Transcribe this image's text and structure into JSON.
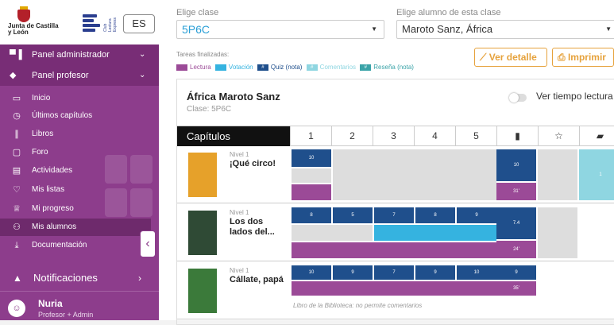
{
  "sidebar": {
    "logo_text": "Junta de Castilla y León",
    "brand_vertical": "Club Lectura Express",
    "lang": "ES",
    "sections": [
      {
        "label": "Panel administrador",
        "icon": "admin-icon"
      },
      {
        "label": "Panel profesor",
        "icon": "teacher-icon"
      }
    ],
    "items": [
      {
        "label": "Inicio",
        "icon": "monitor-icon"
      },
      {
        "label": "Últimos capítulos",
        "icon": "clock-icon"
      },
      {
        "label": "Libros",
        "icon": "books-icon"
      },
      {
        "label": "Foro",
        "icon": "chat-icon"
      },
      {
        "label": "Actividades",
        "icon": "activity-icon"
      },
      {
        "label": "Mis listas",
        "icon": "heart-icon"
      },
      {
        "label": "Mi progreso",
        "icon": "trophy-icon"
      },
      {
        "label": "Mis alumnos",
        "icon": "students-icon"
      },
      {
        "label": "Documentación",
        "icon": "download-icon"
      }
    ],
    "notifications": "Notificaciones",
    "user": {
      "name": "Nuria",
      "role": "Profesor + Admin"
    }
  },
  "main": {
    "class_label": "Elige clase",
    "class_value": "5P6C",
    "student_label": "Elige alumno de esta clase",
    "student_value": "Maroto Sanz, África",
    "legend_title": "Tareas finalizadas:",
    "legend": [
      {
        "label": "Lectura",
        "color": "#9b4a97",
        "mark": ""
      },
      {
        "label": "Votación",
        "color": "#35b3e0",
        "mark": ""
      },
      {
        "label": "Quiz (nota)",
        "color": "#1f4f8c",
        "mark": "#"
      },
      {
        "label": "Comentarios",
        "color": "#8fd6e1",
        "mark": "#"
      },
      {
        "label": "Reseña (nota)",
        "color": "#3aa3a8",
        "mark": "#"
      }
    ],
    "btn_detail": "Ver detalle",
    "btn_print": "Imprimir",
    "student_name": "África Maroto Sanz",
    "student_class": "Clase: 5P6C",
    "toggle_label": "Ver tiempo lectura",
    "table": {
      "col_caps": "Capítulos",
      "cols": [
        "1",
        "2",
        "3",
        "4",
        "5"
      ],
      "rows": [
        {
          "level": "Nivel 1",
          "title": "¡Qué circo!",
          "quiz": [
            "10"
          ],
          "avg": "10",
          "time": "31'",
          "reseña": "1"
        },
        {
          "level": "Nivel 1",
          "title": "Los dos lados del...",
          "quiz": [
            "8",
            "5",
            "7",
            "8",
            "9"
          ],
          "avg": "7.4",
          "time": "24'"
        },
        {
          "level": "Nivel 1",
          "title": "Cállate, papá",
          "quiz": [
            "10",
            "9",
            "7",
            "9",
            "10"
          ],
          "avg": "9",
          "time": "35'",
          "note": "Libro de la Biblioteca: no permite comentarios"
        }
      ]
    }
  }
}
